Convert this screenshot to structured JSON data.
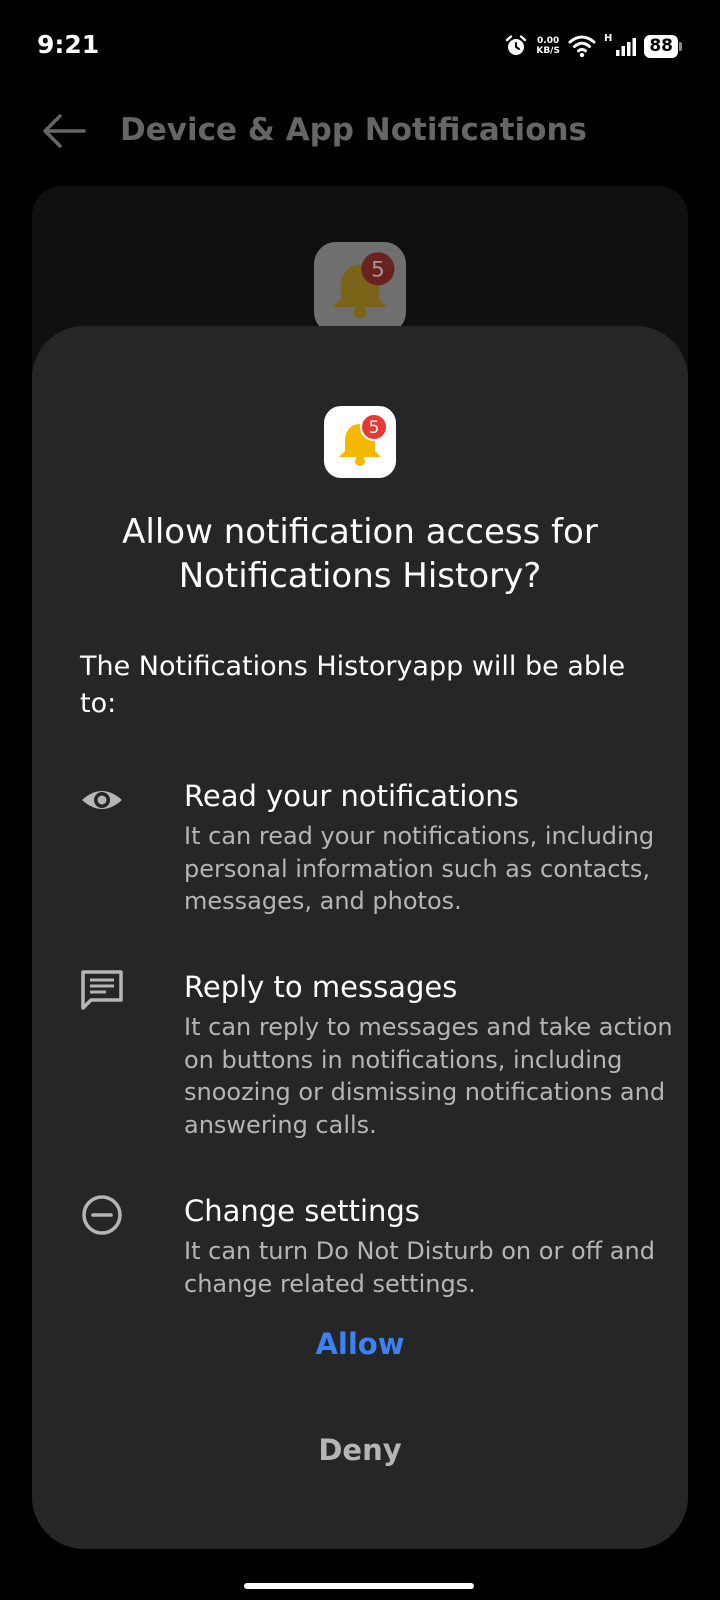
{
  "status_bar": {
    "time": "9:21",
    "net_speed_value": "0.00",
    "net_speed_unit": "KB/S",
    "network_type": "H",
    "battery": "88",
    "icons": [
      "alarm-icon",
      "wifi-icon",
      "signal-icon",
      "battery-icon"
    ]
  },
  "background_page": {
    "title": "Device & App Notifications",
    "back_icon": "back-arrow-icon"
  },
  "app": {
    "badge_count": "5",
    "icon": "bell-icon"
  },
  "dialog": {
    "title": "Allow notification access for Notifications History?",
    "intro": "The Notifications Historyapp will be able to:",
    "permissions": [
      {
        "icon": "eye-icon",
        "title": "Read your notifications",
        "description": "It can read your notifications, including personal information such as contacts, messages, and photos."
      },
      {
        "icon": "message-icon",
        "title": "Reply to messages",
        "description": "It can reply to messages and take action on buttons in notifications, including snoozing or dismissing notifications and answering calls."
      },
      {
        "icon": "do-not-disturb-icon",
        "title": "Change settings",
        "description": "It can turn Do Not Disturb on or off and change related settings."
      }
    ],
    "allow_label": "Allow",
    "deny_label": "Deny"
  },
  "colors": {
    "accent": "#3b82f6",
    "dialog_bg": "#262626",
    "badge": "#e53935",
    "bell": "#f5b800"
  }
}
